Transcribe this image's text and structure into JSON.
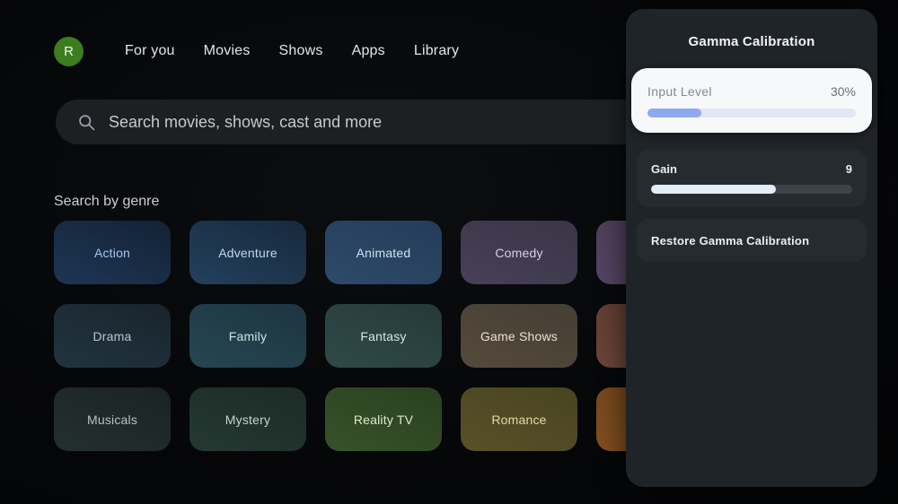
{
  "nav": {
    "avatar_initial": "R",
    "items": [
      {
        "label": "For you"
      },
      {
        "label": "Movies"
      },
      {
        "label": "Shows"
      },
      {
        "label": "Apps"
      },
      {
        "label": "Library"
      }
    ]
  },
  "search": {
    "placeholder": "Search movies, shows, cast and more",
    "icon": "search-icon"
  },
  "genres": {
    "heading": "Search by genre",
    "tiles": [
      {
        "label": "Action",
        "bg": "linear-gradient(205deg,#122235,#1e3654)",
        "label_color": "#a9c6e8"
      },
      {
        "label": "Adventure",
        "bg": "linear-gradient(205deg,#16293d,#23405c)",
        "label_color": "#c3d7ea"
      },
      {
        "label": "Animated",
        "bg": "linear-gradient(205deg,#243c58,#2e4a6a)",
        "label_color": "#cfe0f2"
      },
      {
        "label": "Comedy",
        "bg": "linear-gradient(205deg,#3a3547,#474057)",
        "label_color": "#d3cfe2"
      },
      {
        "label": "",
        "bg": "linear-gradient(205deg,#4a3b52,#544363)",
        "label_color": "#d8d0e0"
      },
      {
        "label": "Drama",
        "bg": "linear-gradient(205deg,#18242c,#223440)",
        "label_color": "#b6c6ce"
      },
      {
        "label": "Family",
        "bg": "linear-gradient(205deg,#1d3540,#264652)",
        "label_color": "#cfe2e6"
      },
      {
        "label": "Fantasy",
        "bg": "linear-gradient(205deg,#253a39,#2f4a48)",
        "label_color": "#d6e6e2"
      },
      {
        "label": "Game Shows",
        "bg": "linear-gradient(205deg,#453e33,#544a3c)",
        "label_color": "#eadfd2"
      },
      {
        "label": "",
        "bg": "linear-gradient(205deg,#58392f,#6a4438)",
        "label_color": "#e6d2c8"
      },
      {
        "label": "Musicals",
        "bg": "linear-gradient(205deg,#1a2324,#242f30)",
        "label_color": "#b4c3c4"
      },
      {
        "label": "Mystery",
        "bg": "linear-gradient(205deg,#1c2b26,#253832)",
        "label_color": "#c6d4ce"
      },
      {
        "label": "Reality TV",
        "bg": "linear-gradient(205deg,#2a4020,#37522a)",
        "label_color": "#dcead0"
      },
      {
        "label": "Romance",
        "bg": "linear-gradient(205deg,#48441f,#575129)",
        "label_color": "#e7d9a4"
      },
      {
        "label": "",
        "bg": "linear-gradient(205deg,#6f4219,#7e4e1f)",
        "label_color": "#ecd4b4"
      }
    ]
  },
  "panel": {
    "title": "Gamma Calibration",
    "sliders": [
      {
        "label": "Input Level",
        "value": "30%",
        "fill": "26%"
      },
      {
        "label": "Gain",
        "value": "9",
        "fill": "62%"
      }
    ],
    "restore_label": "Restore Gamma Calibration"
  },
  "colors": {
    "background": "#060709",
    "panel_bg": "#1f2429",
    "card_bg": "#262b30",
    "focused_card_bg": "#f7f8fa",
    "avatar_green": "#3c7d1f",
    "input_level_fill": "#8fa9ee",
    "input_level_track": "#e0e6f4",
    "gain_fill": "#e3edf5",
    "gain_track": "#3e4349"
  }
}
